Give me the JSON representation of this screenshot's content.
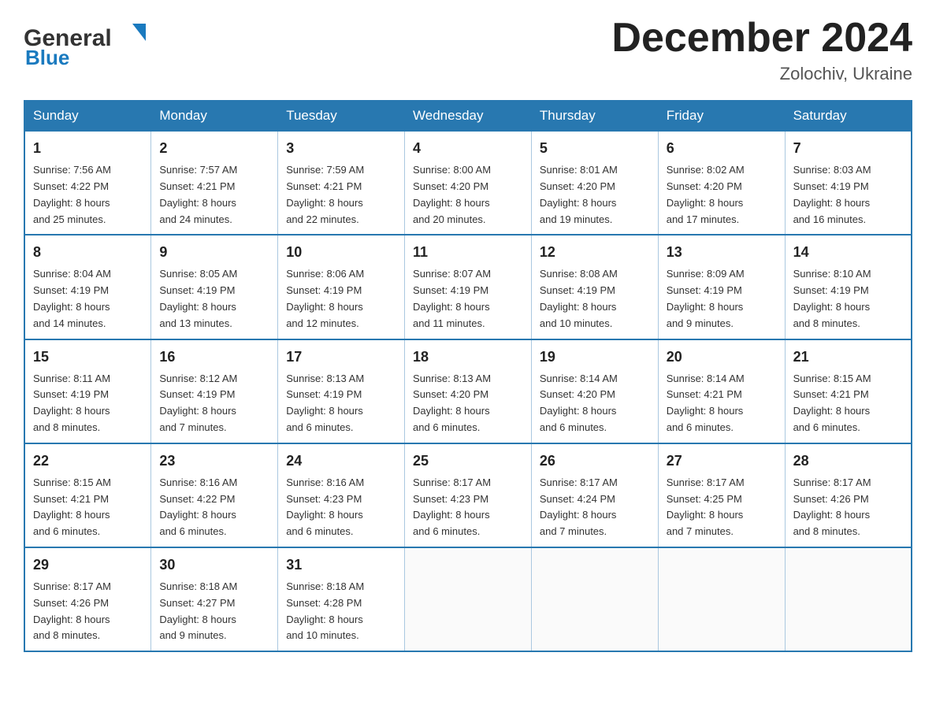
{
  "header": {
    "logo": {
      "general": "General",
      "blue": "Blue",
      "triangle": "▲"
    },
    "title": "December 2024",
    "location": "Zolochiv, Ukraine"
  },
  "days_of_week": [
    "Sunday",
    "Monday",
    "Tuesday",
    "Wednesday",
    "Thursday",
    "Friday",
    "Saturday"
  ],
  "weeks": [
    [
      {
        "day": "1",
        "sunrise": "7:56 AM",
        "sunset": "4:22 PM",
        "daylight": "8 hours and 25 minutes."
      },
      {
        "day": "2",
        "sunrise": "7:57 AM",
        "sunset": "4:21 PM",
        "daylight": "8 hours and 24 minutes."
      },
      {
        "day": "3",
        "sunrise": "7:59 AM",
        "sunset": "4:21 PM",
        "daylight": "8 hours and 22 minutes."
      },
      {
        "day": "4",
        "sunrise": "8:00 AM",
        "sunset": "4:20 PM",
        "daylight": "8 hours and 20 minutes."
      },
      {
        "day": "5",
        "sunrise": "8:01 AM",
        "sunset": "4:20 PM",
        "daylight": "8 hours and 19 minutes."
      },
      {
        "day": "6",
        "sunrise": "8:02 AM",
        "sunset": "4:20 PM",
        "daylight": "8 hours and 17 minutes."
      },
      {
        "day": "7",
        "sunrise": "8:03 AM",
        "sunset": "4:19 PM",
        "daylight": "8 hours and 16 minutes."
      }
    ],
    [
      {
        "day": "8",
        "sunrise": "8:04 AM",
        "sunset": "4:19 PM",
        "daylight": "8 hours and 14 minutes."
      },
      {
        "day": "9",
        "sunrise": "8:05 AM",
        "sunset": "4:19 PM",
        "daylight": "8 hours and 13 minutes."
      },
      {
        "day": "10",
        "sunrise": "8:06 AM",
        "sunset": "4:19 PM",
        "daylight": "8 hours and 12 minutes."
      },
      {
        "day": "11",
        "sunrise": "8:07 AM",
        "sunset": "4:19 PM",
        "daylight": "8 hours and 11 minutes."
      },
      {
        "day": "12",
        "sunrise": "8:08 AM",
        "sunset": "4:19 PM",
        "daylight": "8 hours and 10 minutes."
      },
      {
        "day": "13",
        "sunrise": "8:09 AM",
        "sunset": "4:19 PM",
        "daylight": "8 hours and 9 minutes."
      },
      {
        "day": "14",
        "sunrise": "8:10 AM",
        "sunset": "4:19 PM",
        "daylight": "8 hours and 8 minutes."
      }
    ],
    [
      {
        "day": "15",
        "sunrise": "8:11 AM",
        "sunset": "4:19 PM",
        "daylight": "8 hours and 8 minutes."
      },
      {
        "day": "16",
        "sunrise": "8:12 AM",
        "sunset": "4:19 PM",
        "daylight": "8 hours and 7 minutes."
      },
      {
        "day": "17",
        "sunrise": "8:13 AM",
        "sunset": "4:19 PM",
        "daylight": "8 hours and 6 minutes."
      },
      {
        "day": "18",
        "sunrise": "8:13 AM",
        "sunset": "4:20 PM",
        "daylight": "8 hours and 6 minutes."
      },
      {
        "day": "19",
        "sunrise": "8:14 AM",
        "sunset": "4:20 PM",
        "daylight": "8 hours and 6 minutes."
      },
      {
        "day": "20",
        "sunrise": "8:14 AM",
        "sunset": "4:21 PM",
        "daylight": "8 hours and 6 minutes."
      },
      {
        "day": "21",
        "sunrise": "8:15 AM",
        "sunset": "4:21 PM",
        "daylight": "8 hours and 6 minutes."
      }
    ],
    [
      {
        "day": "22",
        "sunrise": "8:15 AM",
        "sunset": "4:21 PM",
        "daylight": "8 hours and 6 minutes."
      },
      {
        "day": "23",
        "sunrise": "8:16 AM",
        "sunset": "4:22 PM",
        "daylight": "8 hours and 6 minutes."
      },
      {
        "day": "24",
        "sunrise": "8:16 AM",
        "sunset": "4:23 PM",
        "daylight": "8 hours and 6 minutes."
      },
      {
        "day": "25",
        "sunrise": "8:17 AM",
        "sunset": "4:23 PM",
        "daylight": "8 hours and 6 minutes."
      },
      {
        "day": "26",
        "sunrise": "8:17 AM",
        "sunset": "4:24 PM",
        "daylight": "8 hours and 7 minutes."
      },
      {
        "day": "27",
        "sunrise": "8:17 AM",
        "sunset": "4:25 PM",
        "daylight": "8 hours and 7 minutes."
      },
      {
        "day": "28",
        "sunrise": "8:17 AM",
        "sunset": "4:26 PM",
        "daylight": "8 hours and 8 minutes."
      }
    ],
    [
      {
        "day": "29",
        "sunrise": "8:17 AM",
        "sunset": "4:26 PM",
        "daylight": "8 hours and 8 minutes."
      },
      {
        "day": "30",
        "sunrise": "8:18 AM",
        "sunset": "4:27 PM",
        "daylight": "8 hours and 9 minutes."
      },
      {
        "day": "31",
        "sunrise": "8:18 AM",
        "sunset": "4:28 PM",
        "daylight": "8 hours and 10 minutes."
      },
      null,
      null,
      null,
      null
    ]
  ],
  "labels": {
    "sunrise": "Sunrise:",
    "sunset": "Sunset:",
    "daylight": "Daylight:"
  }
}
